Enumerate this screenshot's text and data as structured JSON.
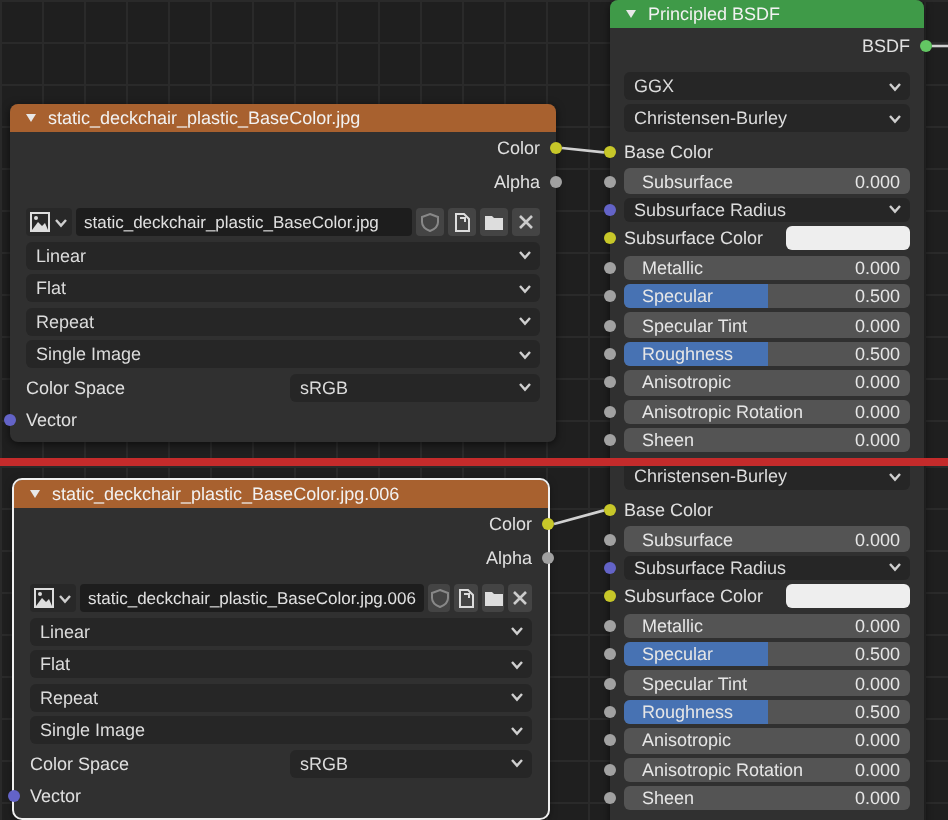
{
  "editors": [
    {
      "image_node": {
        "title": "static_deckchair_plastic_BaseColor.jpg",
        "selected": false,
        "outputs": [
          {
            "label": "Color",
            "color": "#c7c729",
            "linked": true
          },
          {
            "label": "Alpha",
            "color": "#a1a1a1",
            "linked": false
          }
        ],
        "image_name": "static_deckchair_plastic_BaseColor.jpg",
        "dropdowns": [
          "Linear",
          "Flat",
          "Repeat",
          "Single Image"
        ],
        "color_space": {
          "label": "Color Space",
          "value": "sRGB"
        },
        "inputs": [
          {
            "label": "Vector",
            "color": "#6363c7"
          }
        ]
      },
      "bsdf_node": {
        "title": "Principled BSDF",
        "output": {
          "label": "BSDF",
          "color": "#63c763",
          "linked": true
        },
        "dropdowns": [
          "GGX",
          "Christensen-Burley"
        ],
        "inputs": [
          {
            "kind": "label",
            "label": "Base Color",
            "color": "#c7c729",
            "linked": true
          },
          {
            "kind": "slider",
            "label": "Subsurface",
            "value": "0.000",
            "level": 0,
            "color": "#a1a1a1"
          },
          {
            "kind": "dropdown",
            "label": "Subsurface Radius",
            "color": "#6363c7"
          },
          {
            "kind": "swatch",
            "label": "Subsurface Color",
            "color": "#c7c729"
          },
          {
            "kind": "slider",
            "label": "Metallic",
            "value": "0.000",
            "level": 0,
            "color": "#a1a1a1"
          },
          {
            "kind": "slider",
            "label": "Specular",
            "value": "0.500",
            "level": 0.5,
            "color": "#a1a1a1"
          },
          {
            "kind": "slider",
            "label": "Specular Tint",
            "value": "0.000",
            "level": 0,
            "color": "#a1a1a1"
          },
          {
            "kind": "slider",
            "label": "Roughness",
            "value": "0.500",
            "level": 0.5,
            "color": "#a1a1a1"
          },
          {
            "kind": "slider",
            "label": "Anisotropic",
            "value": "0.000",
            "level": 0,
            "color": "#a1a1a1"
          },
          {
            "kind": "slider",
            "label": "Anisotropic Rotation",
            "value": "0.000",
            "level": 0,
            "color": "#a1a1a1"
          },
          {
            "kind": "slider",
            "label": "Sheen",
            "value": "0.000",
            "level": 0,
            "color": "#a1a1a1"
          }
        ]
      }
    },
    {
      "image_node": {
        "title": "static_deckchair_plastic_BaseColor.jpg.006",
        "selected": true,
        "outputs": [
          {
            "label": "Color",
            "color": "#c7c729",
            "linked": true
          },
          {
            "label": "Alpha",
            "color": "#a1a1a1",
            "linked": false
          }
        ],
        "image_name": "static_deckchair_plastic_BaseColor.jpg.006",
        "dropdowns": [
          "Linear",
          "Flat",
          "Repeat",
          "Single Image"
        ],
        "color_space": {
          "label": "Color Space",
          "value": "sRGB"
        },
        "inputs": [
          {
            "label": "Vector",
            "color": "#6363c7"
          }
        ]
      },
      "bsdf_node": {
        "dropdowns": [
          "Christensen-Burley"
        ],
        "inputs": [
          {
            "kind": "label",
            "label": "Base Color",
            "color": "#c7c729",
            "linked": true
          },
          {
            "kind": "slider",
            "label": "Subsurface",
            "value": "0.000",
            "level": 0,
            "color": "#a1a1a1"
          },
          {
            "kind": "dropdown",
            "label": "Subsurface Radius",
            "color": "#6363c7"
          },
          {
            "kind": "swatch",
            "label": "Subsurface Color",
            "color": "#c7c729"
          },
          {
            "kind": "slider",
            "label": "Metallic",
            "value": "0.000",
            "level": 0,
            "color": "#a1a1a1"
          },
          {
            "kind": "slider",
            "label": "Specular",
            "value": "0.500",
            "level": 0.5,
            "color": "#a1a1a1"
          },
          {
            "kind": "slider",
            "label": "Specular Tint",
            "value": "0.000",
            "level": 0,
            "color": "#a1a1a1"
          },
          {
            "kind": "slider",
            "label": "Roughness",
            "value": "0.500",
            "level": 0.5,
            "color": "#a1a1a1"
          },
          {
            "kind": "slider",
            "label": "Anisotropic",
            "value": "0.000",
            "level": 0,
            "color": "#a1a1a1"
          },
          {
            "kind": "slider",
            "label": "Anisotropic Rotation",
            "value": "0.000",
            "level": 0,
            "color": "#a1a1a1"
          },
          {
            "kind": "slider",
            "label": "Sheen",
            "value": "0.000",
            "level": 0,
            "color": "#a1a1a1"
          }
        ]
      }
    }
  ]
}
